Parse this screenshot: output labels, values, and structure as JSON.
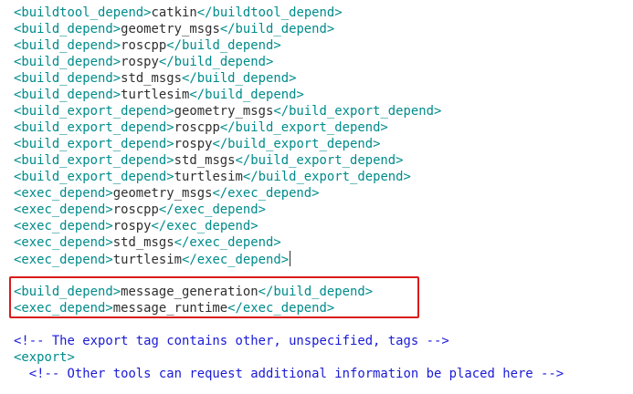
{
  "editor": {
    "cutoff_line": [
      {
        "t": "tag",
        "v": "<"
      },
      {
        "t": "tag",
        "v": "buildtool_depend"
      },
      {
        "t": "tag",
        "v": ">"
      }
    ],
    "lines": [
      [
        {
          "t": "tag",
          "v": "<buildtool_depend>"
        },
        {
          "t": "txt",
          "v": "catkin"
        },
        {
          "t": "tag",
          "v": "</buildtool_depend>"
        }
      ],
      [
        {
          "t": "tag",
          "v": "<build_depend>"
        },
        {
          "t": "txt",
          "v": "geometry_msgs"
        },
        {
          "t": "tag",
          "v": "</build_depend>"
        }
      ],
      [
        {
          "t": "tag",
          "v": "<build_depend>"
        },
        {
          "t": "txt",
          "v": "roscpp"
        },
        {
          "t": "tag",
          "v": "</build_depend>"
        }
      ],
      [
        {
          "t": "tag",
          "v": "<build_depend>"
        },
        {
          "t": "txt",
          "v": "rospy"
        },
        {
          "t": "tag",
          "v": "</build_depend>"
        }
      ],
      [
        {
          "t": "tag",
          "v": "<build_depend>"
        },
        {
          "t": "txt",
          "v": "std_msgs"
        },
        {
          "t": "tag",
          "v": "</build_depend>"
        }
      ],
      [
        {
          "t": "tag",
          "v": "<build_depend>"
        },
        {
          "t": "txt",
          "v": "turtlesim"
        },
        {
          "t": "tag",
          "v": "</build_depend>"
        }
      ],
      [
        {
          "t": "tag",
          "v": "<build_export_depend>"
        },
        {
          "t": "txt",
          "v": "geometry_msgs"
        },
        {
          "t": "tag",
          "v": "</build_export_depend>"
        }
      ],
      [
        {
          "t": "tag",
          "v": "<build_export_depend>"
        },
        {
          "t": "txt",
          "v": "roscpp"
        },
        {
          "t": "tag",
          "v": "</build_export_depend>"
        }
      ],
      [
        {
          "t": "tag",
          "v": "<build_export_depend>"
        },
        {
          "t": "txt",
          "v": "rospy"
        },
        {
          "t": "tag",
          "v": "</build_export_depend>"
        }
      ],
      [
        {
          "t": "tag",
          "v": "<build_export_depend>"
        },
        {
          "t": "txt",
          "v": "std_msgs"
        },
        {
          "t": "tag",
          "v": "</build_export_depend>"
        }
      ],
      [
        {
          "t": "tag",
          "v": "<build_export_depend>"
        },
        {
          "t": "txt",
          "v": "turtlesim"
        },
        {
          "t": "tag",
          "v": "</build_export_depend>"
        }
      ],
      [
        {
          "t": "tag",
          "v": "<exec_depend>"
        },
        {
          "t": "txt",
          "v": "geometry_msgs"
        },
        {
          "t": "tag",
          "v": "</exec_depend>"
        }
      ],
      [
        {
          "t": "tag",
          "v": "<exec_depend>"
        },
        {
          "t": "txt",
          "v": "roscpp"
        },
        {
          "t": "tag",
          "v": "</exec_depend>"
        }
      ],
      [
        {
          "t": "tag",
          "v": "<exec_depend>"
        },
        {
          "t": "txt",
          "v": "rospy"
        },
        {
          "t": "tag",
          "v": "</exec_depend>"
        }
      ],
      [
        {
          "t": "tag",
          "v": "<exec_depend>"
        },
        {
          "t": "txt",
          "v": "std_msgs"
        },
        {
          "t": "tag",
          "v": "</exec_depend>"
        }
      ],
      [
        {
          "t": "tag",
          "v": "<exec_depend>"
        },
        {
          "t": "txt",
          "v": "turtlesim"
        },
        {
          "t": "tag",
          "v": "</exec_depend>"
        }
      ],
      [],
      [
        {
          "t": "tag",
          "v": "<build_depend>"
        },
        {
          "t": "txt",
          "v": "message_generation"
        },
        {
          "t": "tag",
          "v": "</build_depend>"
        }
      ],
      [
        {
          "t": "tag",
          "v": "<exec_depend>"
        },
        {
          "t": "txt",
          "v": "message_runtime"
        },
        {
          "t": "tag",
          "v": "</exec_depend>"
        }
      ],
      [],
      [
        {
          "t": "cmt",
          "v": "<!-- The export tag contains other, unspecified, tags -->"
        }
      ],
      [
        {
          "t": "tag",
          "v": "<export>"
        }
      ],
      [
        {
          "t": "cmt",
          "v": "  <!-- Other tools can request additional information be placed here -->"
        }
      ]
    ],
    "cursor_line_index": 15,
    "highlighted_line_indices": [
      17,
      18
    ],
    "colors": {
      "tag": "#008b8b",
      "text": "#2f2f2f",
      "comment": "#1a1ad6",
      "highlight_border": "#d81b1b"
    }
  }
}
